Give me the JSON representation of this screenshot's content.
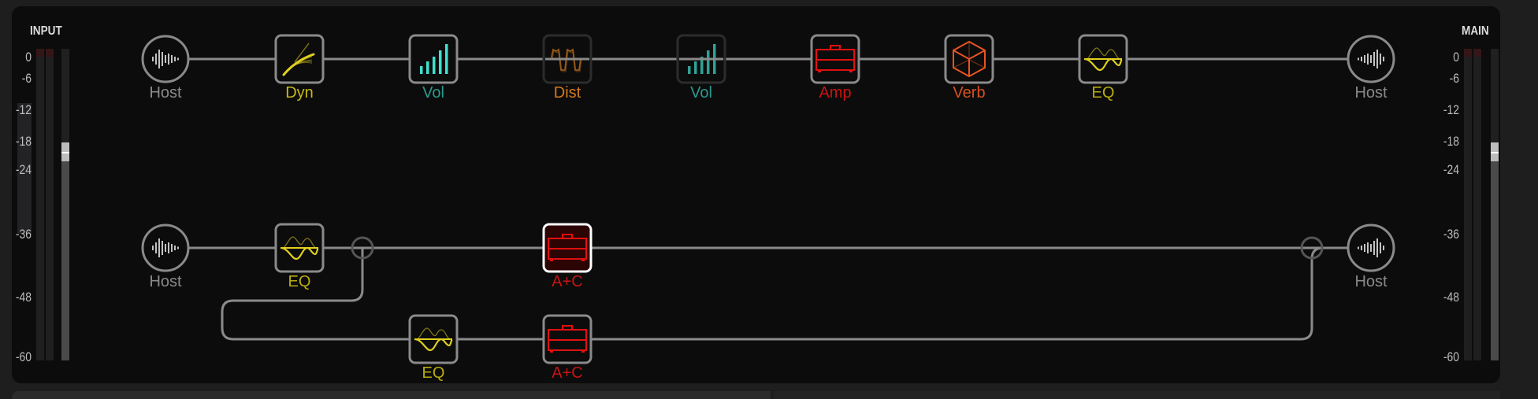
{
  "input_meter": {
    "title": "INPUT",
    "ticks": [
      "0",
      "-6",
      "-12",
      "-18",
      "-24",
      "-36",
      "-48",
      "-60"
    ],
    "level_db": -20,
    "clip_colors": "#3a1a1a"
  },
  "main_meter": {
    "title": "MAIN",
    "ticks": [
      "0",
      "-6",
      "-12",
      "-18",
      "-24",
      "-36",
      "-48",
      "-60"
    ],
    "level_db": -20
  },
  "colors": {
    "host": "#8a8a8a",
    "dyn": "#e0d020",
    "vol": "#40e0d0",
    "vol_label": "#2a9a90",
    "dist": "#d27a1e",
    "amp": "#e01010",
    "amp_label": "#c81414",
    "verb": "#e85420",
    "verb_label": "#d8501e",
    "eq": "#e0d020",
    "eq_label": "#b8ac10",
    "line": "#8a8a8a",
    "selected_fill": "#2c0404"
  },
  "path1": {
    "blocks": [
      {
        "id": "host-in",
        "type": "host",
        "label": "Host",
        "bypassed": false
      },
      {
        "id": "dyn",
        "type": "dyn",
        "label": "Dyn",
        "bypassed": false
      },
      {
        "id": "vol1",
        "type": "vol",
        "label": "Vol",
        "bypassed": false
      },
      {
        "id": "dist",
        "type": "dist",
        "label": "Dist",
        "bypassed": true
      },
      {
        "id": "vol2",
        "type": "vol",
        "label": "Vol",
        "bypassed": true
      },
      {
        "id": "amp",
        "type": "amp",
        "label": "Amp",
        "bypassed": false
      },
      {
        "id": "verb",
        "type": "verb",
        "label": "Verb",
        "bypassed": false
      },
      {
        "id": "eq",
        "type": "eq",
        "label": "EQ",
        "bypassed": false
      },
      {
        "id": "host-out",
        "type": "host",
        "label": "Host",
        "bypassed": false
      }
    ]
  },
  "path2": {
    "blocks": [
      {
        "id": "host-in",
        "type": "host",
        "label": "Host"
      },
      {
        "id": "eq",
        "type": "eq",
        "label": "EQ"
      },
      {
        "id": "ac-a",
        "type": "amp",
        "label": "A+C",
        "selected": true
      },
      {
        "id": "host-out",
        "type": "host",
        "label": "Host"
      }
    ],
    "branch_b": [
      {
        "id": "eq-b",
        "type": "eq",
        "label": "EQ"
      },
      {
        "id": "ac-b",
        "type": "amp",
        "label": "A+C"
      }
    ]
  }
}
